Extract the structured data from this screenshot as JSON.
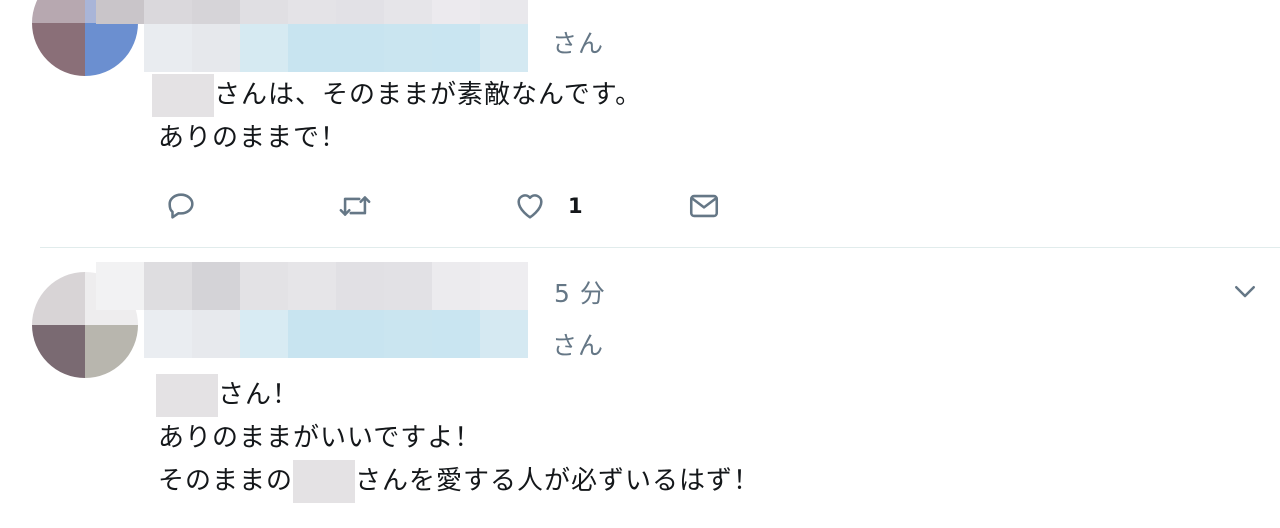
{
  "tweets": [
    {
      "handle_suffix": "さん",
      "time": "",
      "text_line1_rest": "さんは、そのままが素敵なんです。",
      "text_line2": "ありのままで！",
      "actions": {
        "reply_icon": "reply-icon",
        "retweet_icon": "retweet-icon",
        "like_icon": "heart-icon",
        "like_count": "1",
        "dm_icon": "mail-icon"
      }
    },
    {
      "handle_suffix": "さん",
      "time": "5 分",
      "text_line1_rest": "さん！",
      "text_line2": "ありのままがいいですよ！",
      "text_line3_start": "そのままの",
      "text_line3_rest": "さんを愛する人が必ずいるはず！",
      "menu_icon": "chevron-down-icon"
    }
  ],
  "colors": {
    "text": "#14171a",
    "secondary": "#657786",
    "divider": "#e1ecec",
    "handle_blur": "#c8e4f0"
  }
}
